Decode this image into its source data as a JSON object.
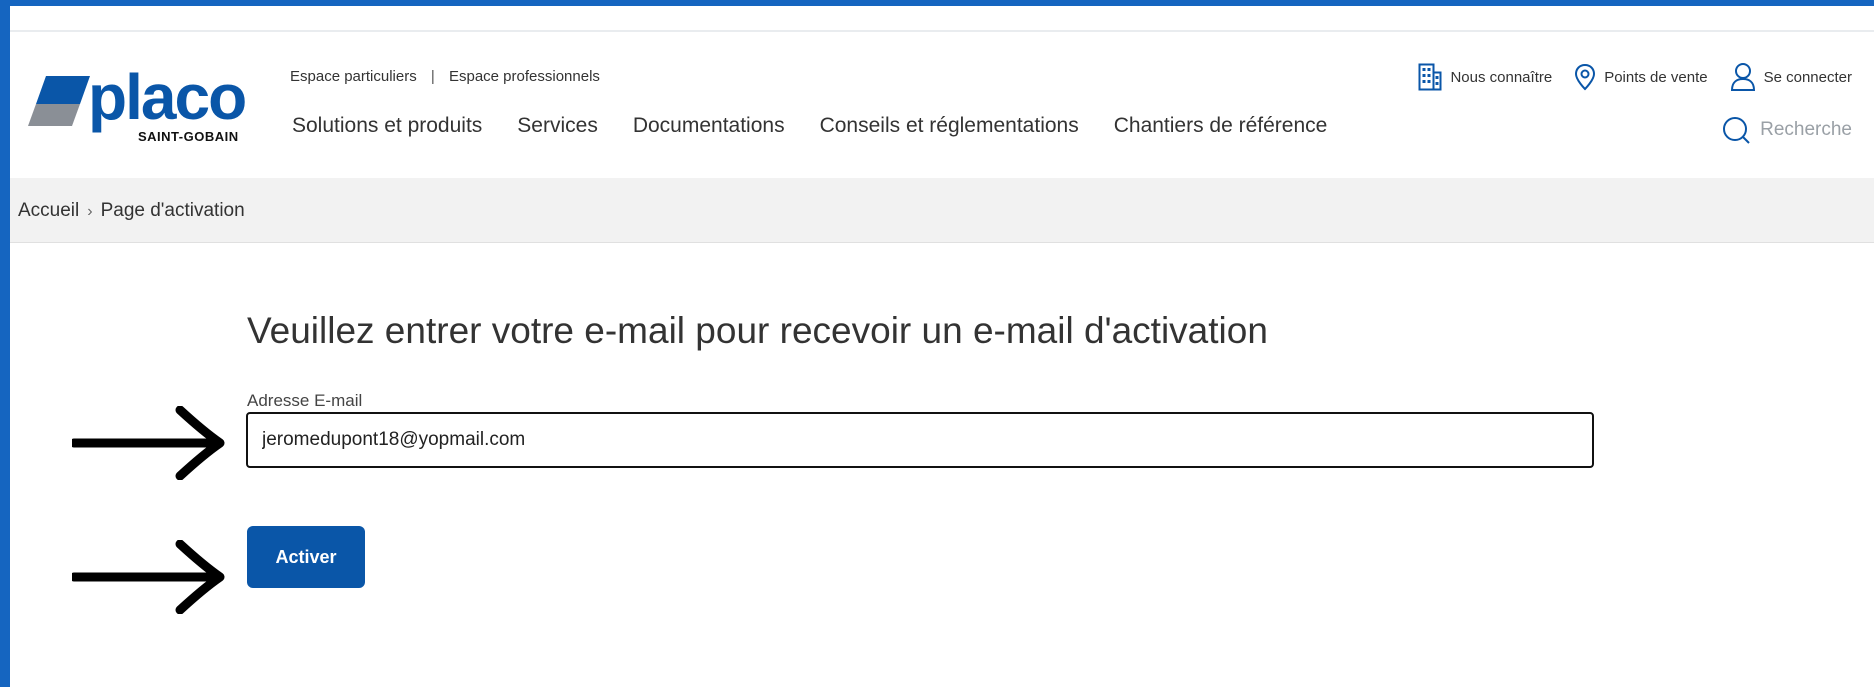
{
  "header": {
    "logo": {
      "name": "placo",
      "subtitle": "SAINT-GOBAIN"
    },
    "spaces": [
      "Espace particuliers",
      "Espace professionnels"
    ],
    "spaces_separator": "|",
    "nav": [
      "Solutions et produits",
      "Services",
      "Documentations",
      "Conseils et réglementations",
      "Chantiers de référence"
    ],
    "utility": [
      {
        "label": "Nous connaître",
        "icon": "building-icon"
      },
      {
        "label": "Points de vente",
        "icon": "location-pin-icon"
      },
      {
        "label": "Se connecter",
        "icon": "user-icon"
      }
    ],
    "search_label": "Recherche"
  },
  "breadcrumb": {
    "home": "Accueil",
    "current": "Page d'activation"
  },
  "form": {
    "title": "Veuillez entrer votre e-mail pour recevoir un e-mail d'activation",
    "email_label": "Adresse E-mail",
    "email_value": "jeromedupont18@yopmail.com",
    "submit_label": "Activer"
  },
  "colors": {
    "brand": "#0a56a8",
    "frame": "#1565c0",
    "breadcrumb_bg": "#f2f2f2"
  }
}
